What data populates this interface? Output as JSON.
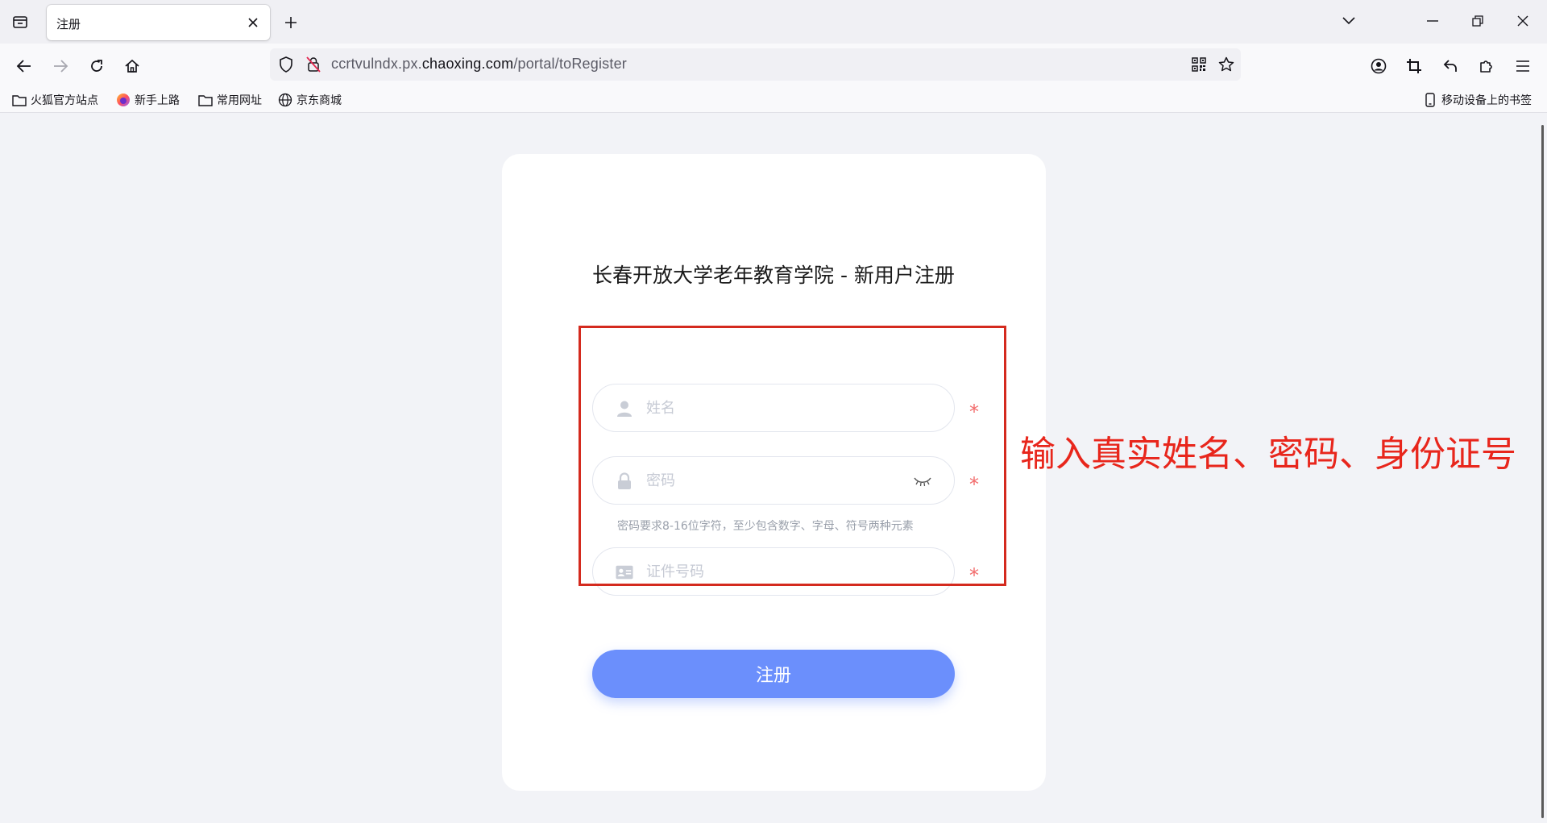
{
  "browser": {
    "tab_title": "注册",
    "url_host_prefix": "ccrtvulndx.px.",
    "url_host_domain": "chaoxing.com",
    "url_path": "/portal/toRegister",
    "bookmarks": [
      {
        "label": "火狐官方站点",
        "icon": "folder-icon"
      },
      {
        "label": "新手上路",
        "icon": "firefox-icon"
      },
      {
        "label": "常用网址",
        "icon": "folder-icon"
      },
      {
        "label": "京东商城",
        "icon": "globe-icon"
      }
    ],
    "mobile_bookmarks": "移动设备上的书签"
  },
  "form": {
    "title": "长春开放大学老年教育学院 - 新用户注册",
    "name_placeholder": "姓名",
    "password_placeholder": "密码",
    "password_hint": "密码要求8-16位字符，至少包含数字、字母、符号两种元素",
    "id_placeholder": "证件号码",
    "required_mark": "*",
    "submit_label": "注册"
  },
  "annotation": {
    "text": "输入真实姓名、密码、身份证号",
    "color": "#e8261c"
  },
  "colors": {
    "accent": "#6b8ffc",
    "required": "#f26b6b",
    "highlight": "#d42a1e"
  }
}
